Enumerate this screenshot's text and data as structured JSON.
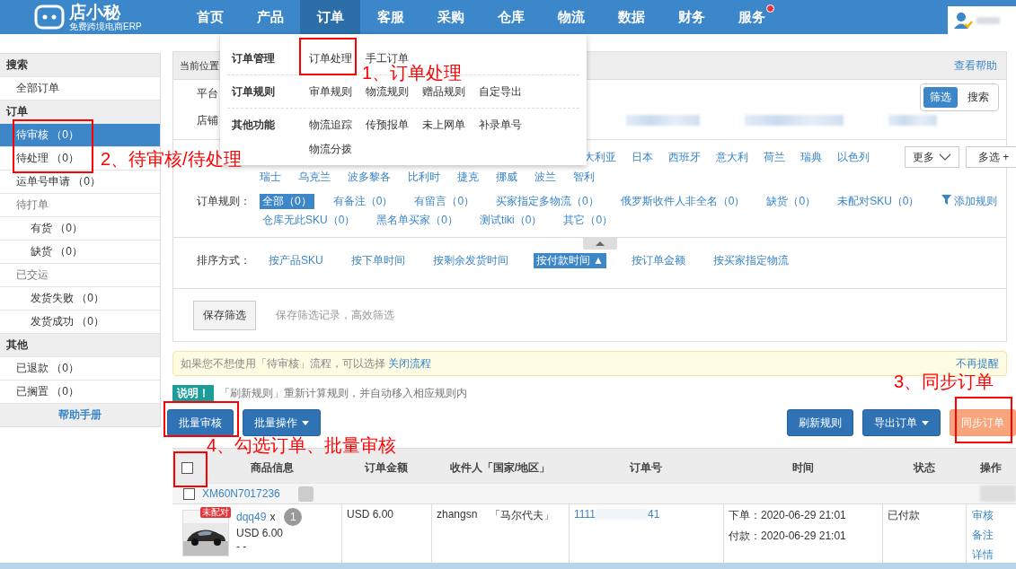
{
  "nav": {
    "logo_title": "店小秘",
    "logo_subtitle": "免费跨境电商ERP",
    "items": [
      {
        "label": "首页",
        "selected": false,
        "notice": false
      },
      {
        "label": "产品",
        "selected": false,
        "notice": false
      },
      {
        "label": "订单",
        "selected": true,
        "notice": false
      },
      {
        "label": "客服",
        "selected": false,
        "notice": false
      },
      {
        "label": "采购",
        "selected": false,
        "notice": false
      },
      {
        "label": "仓库",
        "selected": false,
        "notice": false
      },
      {
        "label": "物流",
        "selected": false,
        "notice": false
      },
      {
        "label": "数据",
        "selected": false,
        "notice": false
      },
      {
        "label": "财务",
        "selected": false,
        "notice": false
      },
      {
        "label": "服务",
        "selected": false,
        "notice": true
      }
    ]
  },
  "order_menu": [
    {
      "title": "订单管理",
      "links": [
        "订单处理",
        "手工订单"
      ]
    },
    {
      "title": "订单规则",
      "links": [
        "审单规则",
        "物流规则",
        "赠品规则",
        "自定导出"
      ]
    },
    {
      "title": "其他功能",
      "links": [
        "物流追踪",
        "传预报单",
        "未上网单",
        "补录单号",
        "物流分拨"
      ]
    }
  ],
  "sidebar": [
    {
      "label": "搜索",
      "kind": "header",
      "selected": false
    },
    {
      "label": "全部订单",
      "kind": "item",
      "selected": false
    },
    {
      "label": "订单",
      "kind": "header",
      "selected": false
    },
    {
      "label": "待审核 （0）",
      "kind": "item",
      "selected": true
    },
    {
      "label": "待处理 （0）",
      "kind": "item",
      "selected": false
    },
    {
      "label": "运单号申请 （0）",
      "kind": "item",
      "selected": false
    },
    {
      "label": "待打单",
      "kind": "group",
      "selected": false
    },
    {
      "label": "有货 （0）",
      "kind": "sub",
      "selected": false
    },
    {
      "label": "缺货 （0）",
      "kind": "sub",
      "selected": false
    },
    {
      "label": "已交运",
      "kind": "group",
      "selected": false
    },
    {
      "label": "发货失败 （0）",
      "kind": "sub",
      "selected": false
    },
    {
      "label": "发货成功 （0）",
      "kind": "sub",
      "selected": false
    },
    {
      "label": "其他",
      "kind": "header",
      "selected": false
    },
    {
      "label": "已退款 （0）",
      "kind": "item",
      "selected": false
    },
    {
      "label": "已搁置 （0）",
      "kind": "item",
      "selected": false
    },
    {
      "label": "帮助手册",
      "kind": "help",
      "selected": false
    }
  ],
  "panel": {
    "location": "当前位置",
    "help": "查看帮助",
    "platform_label": "平台",
    "shop_label": "店铺",
    "mode_toggle": [
      {
        "label": "筛选",
        "selected": true
      },
      {
        "label": "搜索",
        "selected": false
      }
    ],
    "country_lines": [
      [
        "大利亚",
        "日本",
        "西班牙",
        "意大利",
        "荷兰",
        "瑞典",
        "以色列"
      ],
      [
        "瑞士",
        "乌克兰",
        "波多黎各",
        "比利时",
        "捷克",
        "挪威",
        "波兰",
        "智利"
      ]
    ],
    "more_button": "更多",
    "multi_button": "多选 +",
    "rules_label": "订单规则：",
    "rule_lines": [
      [
        {
          "label": "全部（0）",
          "selected": true
        },
        {
          "label": "有备注（0）",
          "selected": false
        },
        {
          "label": "有留言（0）",
          "selected": false
        },
        {
          "label": "买家指定多物流（0）",
          "selected": false
        },
        {
          "label": "俄罗斯收件人非全名（0）",
          "selected": false
        },
        {
          "label": "缺货（0）",
          "selected": false
        },
        {
          "label": "未配对SKU（0）",
          "selected": false
        }
      ],
      [
        {
          "label": "仓库无此SKU（0）",
          "selected": false
        },
        {
          "label": "黑名单买家（0）",
          "selected": false
        },
        {
          "label": "测试tiki（0）",
          "selected": false
        },
        {
          "label": "其它（0）",
          "selected": false
        }
      ]
    ],
    "add_rule": "添加规则",
    "sort_label": "排序方式：",
    "sort_options": [
      {
        "label": "按产品SKU",
        "selected": false
      },
      {
        "label": "按下单时间",
        "selected": false
      },
      {
        "label": "按剩余发货时间",
        "selected": false
      },
      {
        "label": "按付款时间",
        "selected": true,
        "arrow": "▲"
      },
      {
        "label": "按订单金额",
        "selected": false
      },
      {
        "label": "按买家指定物流",
        "selected": false
      }
    ],
    "save_button": "保存筛选",
    "save_hint": "保存筛选记录，高效筛选"
  },
  "notice": {
    "text": "如果您不想使用「待审核」流程，可以选择",
    "link": "关闭流程",
    "dismiss": "不再提醒"
  },
  "explain": {
    "tag": "说明！",
    "text": "「刷新规则」重新计算规则，并自动移入相应规则内"
  },
  "actions_left": [
    {
      "label": "批量审核",
      "kind": "primary",
      "caret": false
    },
    {
      "label": "批量操作",
      "kind": "primary",
      "caret": true
    }
  ],
  "actions_right": [
    {
      "label": "刷新规则",
      "kind": "primary",
      "caret": false
    },
    {
      "label": "导出订单",
      "kind": "primary",
      "caret": true
    },
    {
      "label": "同步订单",
      "kind": "sync",
      "caret": false
    }
  ],
  "table": {
    "select_all": {
      "checked": false
    },
    "columns": [
      "商品信息",
      "订单金额",
      "收件人「国家/地区」",
      "订单号",
      "时间",
      "状态",
      "操作"
    ],
    "group": {
      "checked": false,
      "order_id": "XM60N7017236"
    },
    "item": {
      "badge": "未配对",
      "sku": "dqq49",
      "times": "x",
      "qty": "1",
      "price": "USD 6.00",
      "note": "- -",
      "amount": "USD 6.00",
      "recipient": "zhangsn",
      "country": "「马尔代夫」",
      "order_no_start": "1111",
      "order_no_end": "41",
      "placed": "下单：2020-06-29 21:01",
      "paid": "付款：2020-06-29 21:01",
      "status": "已付款",
      "ops": [
        "审核",
        "备注",
        "详情"
      ]
    }
  },
  "annotations": [
    {
      "text": "1、订单处理"
    },
    {
      "text": "2、待审核/待处理"
    },
    {
      "text": "3、同步订单"
    },
    {
      "text": "4、勾选订单、批量审核"
    }
  ]
}
